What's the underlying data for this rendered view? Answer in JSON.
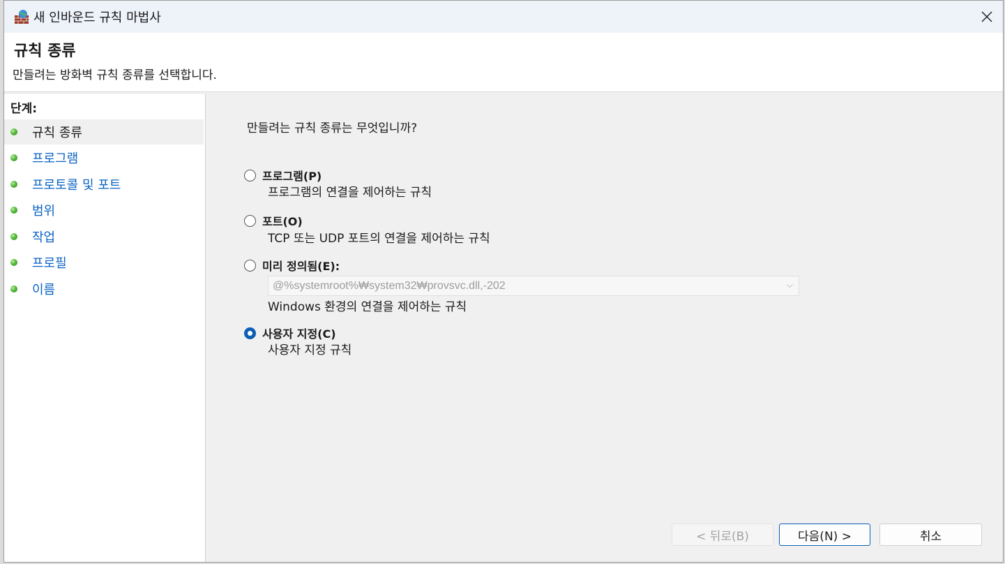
{
  "window": {
    "title": "새 인바운드 규칙 마법사",
    "close_label": "✕"
  },
  "header": {
    "title": "규칙 종류",
    "description": "만들려는 방화벽 규칙 종류를 선택합니다."
  },
  "steps": {
    "heading": "단계:",
    "items": [
      {
        "label": "규칙 종류",
        "active": true
      },
      {
        "label": "프로그램"
      },
      {
        "label": "프로토콜 및 포트"
      },
      {
        "label": "범위"
      },
      {
        "label": "작업"
      },
      {
        "label": "프로필"
      },
      {
        "label": "이름"
      }
    ]
  },
  "main": {
    "question": "만들려는 규칙 종류는 무엇입니까?",
    "options": [
      {
        "label": "프로그램(P)",
        "description": "프로그램의 연결을 제어하는 규칙",
        "checked": false
      },
      {
        "label": "포트(O)",
        "description": "TCP 또는 UDP 포트의 연결을 제어하는 규칙",
        "checked": false
      },
      {
        "label": "미리 정의됨(E):",
        "description": "Windows 환경의 연결을 제어하는 규칙",
        "checked": false,
        "dropdown_value": "@%systemroot%₩system32₩provsvc.dll,-202"
      },
      {
        "label": "사용자 지정(C)",
        "description": "사용자 지정 규칙",
        "checked": true
      }
    ]
  },
  "buttons": {
    "back": "< 뒤로(B)",
    "next": "다음(N) >",
    "cancel": "취소"
  },
  "colors": {
    "link": "#0b63c4",
    "accent": "#0a5fb4",
    "titlebar": "#eef2f9"
  }
}
